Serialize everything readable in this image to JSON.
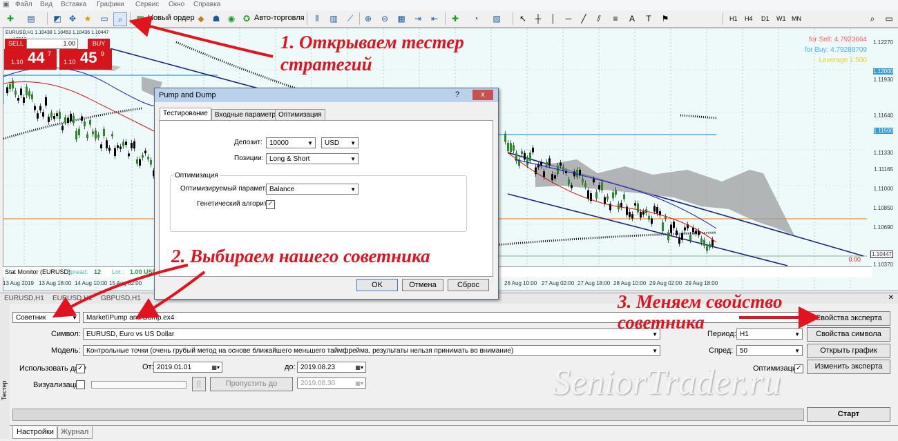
{
  "menu": [
    "Файл",
    "Вид",
    "Вставка",
    "Графики",
    "Сервис",
    "Окно",
    "Справка"
  ],
  "toolbar": {
    "new_order": "Новый ордер",
    "auto_trading": "Авто-торговля",
    "timeframes": [
      "H1",
      "H4",
      "D1",
      "W1",
      "MN"
    ]
  },
  "chart": {
    "symbol_info": "EURUSD,H1  1.10438 1.10453 1.10436 1.10447",
    "subinfo": "17918",
    "sell_label": "SELL",
    "buy_label": "BUY",
    "lot": "1.00",
    "sell_price_small": "1.10",
    "sell_price_big": "44",
    "sell_price_sup": "7",
    "buy_price_small": "1.10",
    "buy_price_big": "45",
    "buy_price_sup": "9",
    "for_sell": "for Sell: 4.7923664",
    "for_buy": "for Buy: 4.79288709",
    "leverage": "Leverage 1:500",
    "price_levels": [
      "1.12270",
      "1.12000",
      "1.11930",
      "1.11640",
      "1.11500",
      "1.11330",
      "1.11165",
      "1.11000",
      "1.10850",
      "1.10690",
      "1.10447",
      "1.10370"
    ],
    "current_price": "1.10447",
    "zero_value": "0.00",
    "stat_monitor": {
      "title": "Stat Monitor (EURUSD)",
      "spread_label": "Spread:",
      "spread_value": "12",
      "lot_label": "Lot :",
      "lot_value": "1.00 USD"
    },
    "time_labels": [
      "13 Aug 2019",
      "13 Aug 18:00",
      "14 Aug 10:00",
      "15 Aug 02:00",
      "26 Aug 10:00",
      "27 Aug 02:00",
      "27 Aug 18:00",
      "28 Aug 10:00",
      "29 Aug 02:00",
      "29 Aug 18:00"
    ],
    "tabs": [
      "EURUSD,H1",
      "EURUSD,H1",
      "GBPUSD,H1"
    ]
  },
  "dialog": {
    "title": "Pump and Dump",
    "help": "?",
    "close": "x",
    "tabs": [
      "Тестирование",
      "Входные параметры",
      "Оптимизация"
    ],
    "deposit_label": "Депозит:",
    "deposit_value": "10000",
    "currency": "USD",
    "positions_label": "Позиции:",
    "positions_value": "Long & Short",
    "optimization_group": "Оптимизация",
    "opt_param_label": "Оптимизируемый параметр:",
    "opt_param_value": "Balance",
    "genetic_label": "Генетический алгоритм",
    "ok": "OK",
    "cancel": "Отмена",
    "reset": "Сброс"
  },
  "tester": {
    "type_value": "Советник",
    "expert_path": "Market\\Pump and Dump.ex4",
    "symbol_label": "Символ:",
    "symbol_value": "EURUSD, Euro vs US Dollar",
    "model_label": "Модель:",
    "model_value": "Контрольные точки (очень грубый метод на основе ближайшего меньшего таймфрейма, результаты нельзя принимать во внимание)",
    "use_date_label": "Использовать дату",
    "from_label": "От:",
    "from_value": "2019.01.01",
    "to_label": "до:",
    "to_value": "2019.08.23",
    "visualization_label": "Визуализация",
    "skip_to_label": "Пропустить до",
    "skip_to_value": "2019.08.30",
    "pause": "||",
    "period_label": "Период:",
    "period_value": "H1",
    "spread_label": "Спред:",
    "spread_value": "50",
    "optimization_label": "Оптимизация",
    "btn_expert_props": "Свойства эксперта",
    "btn_symbol_props": "Свойства символа",
    "btn_open_chart": "Открыть график",
    "btn_modify_expert": "Изменить эксперта",
    "btn_start": "Старт",
    "vertical_tab": "Тестер"
  },
  "bottom_tabs": [
    "Настройки",
    "Журнал"
  ],
  "annotations": {
    "step1_line1": "1. Открываем тестер",
    "step1_line2": "стратегий",
    "step2": "2. Выбираем нашего советника",
    "step3_line1": "3. Меняем свойство",
    "step3_line2": "советника"
  },
  "watermark": "SeniorTrader.ru",
  "colors": {
    "sell_buy_red": "#d4151c",
    "annotation_red": "#e0141e",
    "chart_bg": "#eef9fa",
    "channel_navy": "#1a237e",
    "cloud_gray": "#9e9e9e",
    "orange_level": "#f28c28",
    "blue_level": "#3399dd",
    "for_sell_color": "#ff5a5a",
    "for_buy_color": "#3cb4ff",
    "leverage_color": "#e6d21e"
  }
}
